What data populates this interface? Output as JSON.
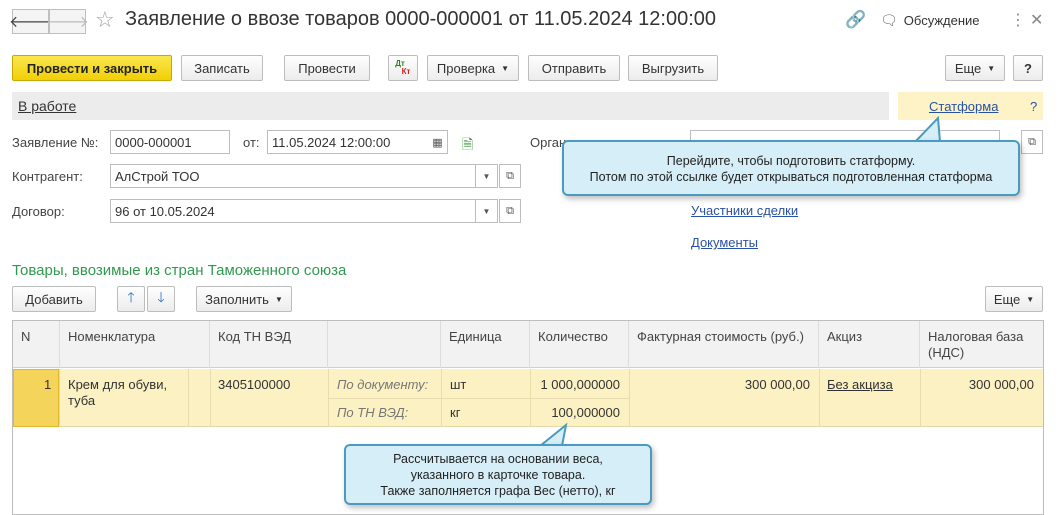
{
  "header": {
    "title": "Заявление о ввозе товаров 0000-000001 от 11.05.2024 12:00:00",
    "discuss": "Обсуждение"
  },
  "toolbar": {
    "post_close": "Провести и закрыть",
    "save": "Записать",
    "post": "Провести",
    "dtkt_top": "Дт",
    "dtkt_bottom": "Кт",
    "check": "Проверка",
    "send": "Отправить",
    "unload": "Выгрузить",
    "more": "Еще",
    "help": "?"
  },
  "status": {
    "state": "В работе",
    "statform_link": "Статформа",
    "help": "?"
  },
  "form": {
    "number_label": "Заявление №:",
    "number_value": "0000-000001",
    "date_label": "от:",
    "date_value": "11.05.2024 12:00:00",
    "org_label": "Орган",
    "counterparty_label": "Контрагент:",
    "counterparty_value": "АлСтрой ТОО",
    "contract_label": "Договор:",
    "contract_value": "96 от 10.05.2024",
    "participants_link": "Участники сделки",
    "documents_link": "Документы"
  },
  "section": {
    "title": "Товары, ввозимые из стран Таможенного союза",
    "add": "Добавить",
    "fill": "Заполнить",
    "more": "Еще"
  },
  "table": {
    "columns": {
      "n": "N",
      "nomenclature": "Номенклатура",
      "code": "Код ТН ВЭД",
      "unit": "Единица",
      "qty": "Количество",
      "invoice": "Фактурная стоимость (руб.)",
      "excise": "Акциз",
      "taxbase": "Налоговая база (НДС)"
    },
    "rows": [
      {
        "n": "1",
        "nomenclature_line1": "Крем для обуви,",
        "nomenclature_line2": "туба",
        "code": "3405100000",
        "by_doc_label": "По документу:",
        "by_tnved_label": "По ТН ВЭД:",
        "unit_doc": "шт",
        "unit_tnved": "кг",
        "qty_doc": "1 000,000000",
        "qty_tnved": "100,000000",
        "invoice": "300 000,00",
        "excise": "Без акциза",
        "taxbase": "300 000,00"
      }
    ]
  },
  "tooltips": {
    "statform_line1": "Перейдите, чтобы подготовить статформу.",
    "statform_line2": "Потом по этой ссылке будет открываться подготовленная статформа",
    "weight_line1": "Рассчитывается на основании веса,",
    "weight_line2": "указанного в карточке товара.",
    "weight_line3": "Также заполняется графа Вес (нетто), кг"
  },
  "colors": {
    "primary_button": "#f1cf05",
    "link": "#2952a3",
    "section_title": "#2f9a4e",
    "selected_row": "#fbf1c3",
    "tooltip_bg": "#d6eef7",
    "tooltip_border": "#4a9bbf"
  }
}
